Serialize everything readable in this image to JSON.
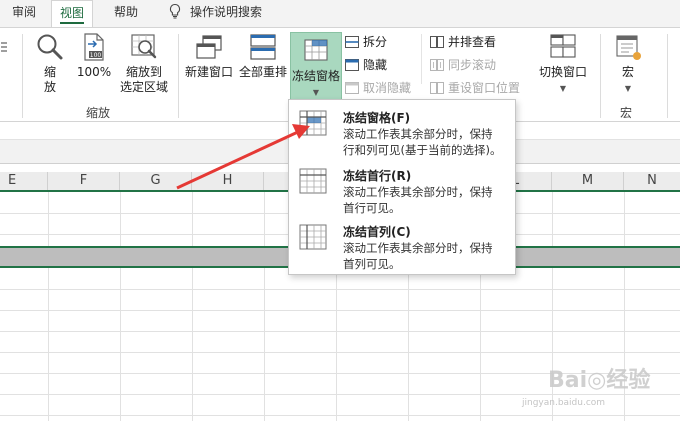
{
  "tabs": [
    {
      "label": "审阅"
    },
    {
      "label": "视图",
      "active": true
    },
    {
      "label": "帮助"
    },
    {
      "label": "操作说明搜索",
      "icon": "lightbulb-icon"
    }
  ],
  "ribbon": {
    "zoom_group": {
      "label": "缩放",
      "buttons": [
        {
          "label": "缩\n放",
          "icon": "magnifier-icon"
        },
        {
          "label": "100%",
          "icon": "zoom-100-icon"
        },
        {
          "label": "缩放到\n选定区域",
          "icon": "zoom-selection-icon"
        }
      ]
    },
    "window_group": {
      "new_window": "新建窗口",
      "arrange_all": "全部重排",
      "freeze_panes": "冻结窗格",
      "split": "拆分",
      "hide": "隐藏",
      "unhide": "取消隐藏",
      "side_by_side": "并排查看",
      "sync_scroll": "同步滚动",
      "reset_position": "重设窗口位置",
      "switch_windows": "切换窗口"
    },
    "macro_group": {
      "button": "宏",
      "label": "宏"
    }
  },
  "grid": {
    "columns": [
      "E",
      "F",
      "G",
      "H",
      "L",
      "M",
      "N"
    ]
  },
  "freeze_menu": {
    "items": [
      {
        "title": "冻结窗格(F)",
        "desc_line1": "滚动工作表其余部分时，保持",
        "desc_line2": "行和列可见(基于当前的选择)。"
      },
      {
        "title": "冻结首行(R)",
        "desc_line1": "滚动工作表其余部分时，保持",
        "desc_line2": "首行可见。"
      },
      {
        "title": "冻结首列(C)",
        "desc_line1": "滚动工作表其余部分时，保持",
        "desc_line2": "首列可见。"
      }
    ]
  },
  "colors": {
    "accent_green": "#217346",
    "selected_button": "#a9d8bf",
    "arrow_red": "#e53935"
  }
}
